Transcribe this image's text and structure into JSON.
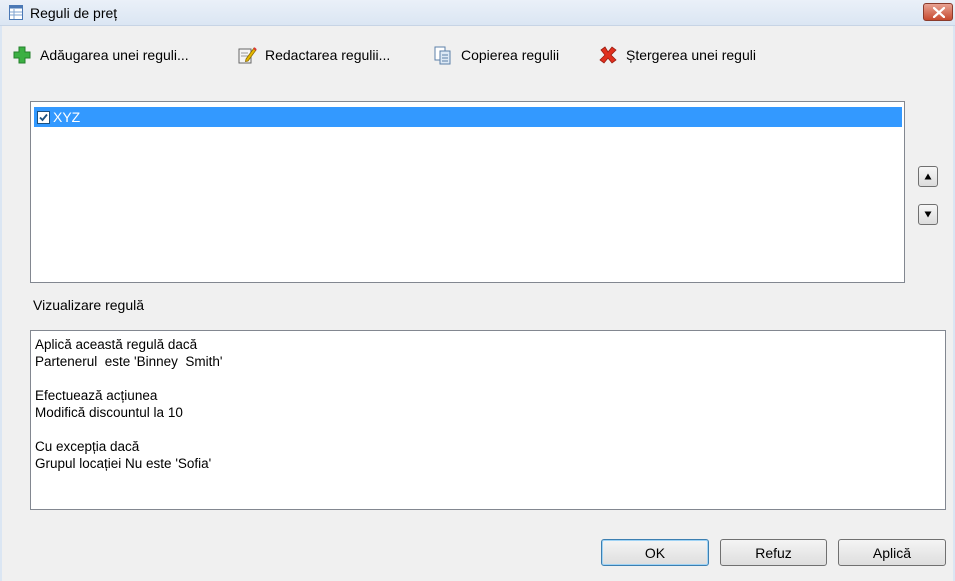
{
  "window": {
    "title": "Reguli de preț",
    "icon": "spreadsheet-icon",
    "close_icon": "close-icon"
  },
  "toolbar": {
    "add_label": "Adăugarea unei reguli...",
    "add_icon": "plus-icon",
    "edit_label": "Redactarea regulii...",
    "edit_icon": "edit-icon",
    "copy_label": "Copierea regulii",
    "copy_icon": "copy-icon",
    "delete_label": "Ștergerea unei reguli",
    "delete_icon": "delete-icon"
  },
  "rules": [
    {
      "name": "XYZ",
      "checked": true,
      "selected": true
    }
  ],
  "preview": {
    "label": "Vizualizare regulă",
    "lines": [
      "Aplică această regulă dacă",
      "Partenerul  este 'Binney  Smith'",
      "",
      "Efectuează acțiunea",
      "Modifică discountul la 10",
      "",
      "Cu excepția dacă",
      "Grupul locației Nu este 'Sofia'"
    ]
  },
  "buttons": {
    "ok": "OK",
    "cancel": "Refuz",
    "apply": "Aplică"
  },
  "colors": {
    "selection": "#3399ff",
    "close_button": "#c74a2f",
    "add_icon": "#3cb043",
    "delete_icon": "#e0301e"
  }
}
